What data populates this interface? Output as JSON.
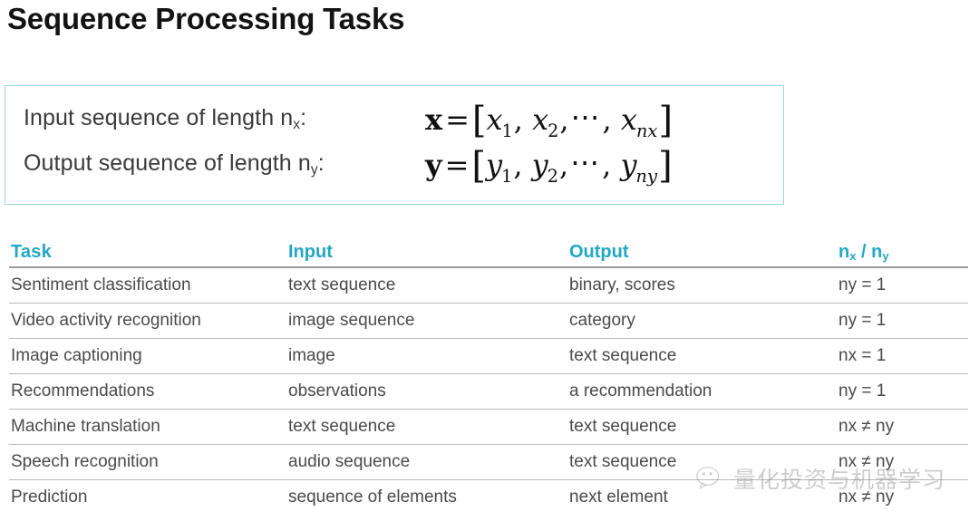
{
  "slide": {
    "title": "Sequence Processing Tasks"
  },
  "formula_box": {
    "border_color": "#9ed4e4",
    "rows": [
      {
        "label_prefix": "Input sequence of length n",
        "label_sub": "x",
        "label_suffix": ":",
        "vector": "x",
        "equals": "=",
        "open_bracket": "[",
        "close_bracket": "]",
        "term1": "x",
        "term1_sub": "1",
        "term2": "x",
        "term2_sub": "2",
        "dots": "⋯",
        "termn": "x",
        "termn_sub": "n",
        "termn_subsub": "x",
        "comma": ","
      },
      {
        "label_prefix": "Output sequence of length n",
        "label_sub": "y",
        "label_suffix": ":",
        "vector": "y",
        "equals": "=",
        "open_bracket": "[",
        "close_bracket": "]",
        "term1": "y",
        "term1_sub": "1",
        "term2": "y",
        "term2_sub": "2",
        "dots": "⋯",
        "termn": "y",
        "termn_sub": "n",
        "termn_subsub": "y",
        "comma": ","
      }
    ]
  },
  "table": {
    "header_color": "#22a7c4",
    "headers": {
      "task": "Task",
      "input": "Input",
      "output": "Output",
      "n_prefix": "n",
      "n_sub_x": "x",
      "n_slash": " / n",
      "n_sub_y": "y"
    },
    "rows": [
      {
        "task": "Sentiment classification",
        "input": "text sequence",
        "output": "binary, scores",
        "n": "ny = 1"
      },
      {
        "task": "Video activity recognition",
        "input": "image sequence",
        "output": "category",
        "n": "ny = 1"
      },
      {
        "task": "Image captioning",
        "input": "image",
        "output": "text sequence",
        "n": "nx = 1"
      },
      {
        "task": "Recommendations",
        "input": "observations",
        "output": "a recommendation",
        "n": "ny = 1"
      },
      {
        "task": "Machine translation",
        "input": "text sequence",
        "output": "text sequence",
        "n": "nx ≠ ny"
      },
      {
        "task": "Speech recognition",
        "input": "audio sequence",
        "output": "text sequence",
        "n": "nx ≠ ny"
      },
      {
        "task": "Prediction",
        "input": "sequence of elements",
        "output": "next element",
        "n": "nx ≠ ny"
      }
    ]
  },
  "watermark": {
    "icon": "wechat-icon",
    "text": "量化投资与机器学习"
  }
}
